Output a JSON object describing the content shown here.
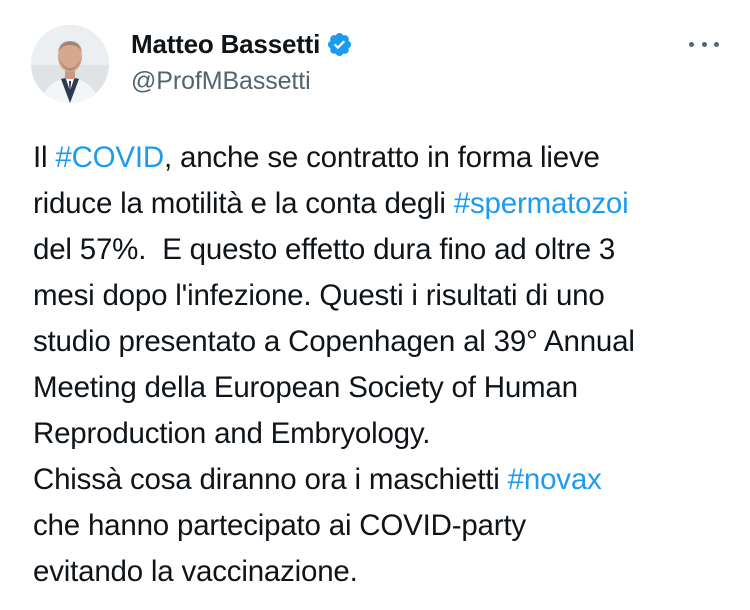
{
  "author": {
    "display_name": "Matteo Bassetti",
    "handle": "@ProfMBassetti",
    "verified_color": "#1d9bf0",
    "avatar_icon": "profile-photo"
  },
  "menu_icon": "more-horizontal-icon",
  "colors": {
    "text": "#0f1419",
    "secondary": "#536471",
    "link": "#1d9bf0"
  },
  "tweet": {
    "lines": [
      [
        {
          "text": "Il ",
          "type": "text"
        },
        {
          "text": "#COVID",
          "type": "hashtag"
        },
        {
          "text": ", anche se contratto in forma lieve",
          "type": "text"
        }
      ],
      [
        {
          "text": "riduce la motilità e la conta degli ",
          "type": "text"
        },
        {
          "text": "#spermatozoi",
          "type": "hashtag"
        }
      ],
      [
        {
          "text": "del 57%.  E questo effetto dura fino ad oltre 3",
          "type": "text"
        }
      ],
      [
        {
          "text": "mesi dopo l'infezione. Questi i risultati di uno",
          "type": "text"
        }
      ],
      [
        {
          "text": "studio presentato a Copenhagen al 39° Annual",
          "type": "text"
        }
      ],
      [
        {
          "text": "Meeting della European Society of Human",
          "type": "text"
        }
      ],
      [
        {
          "text": "Reproduction and Embryology.",
          "type": "text"
        }
      ],
      [
        {
          "text": "Chissà cosa diranno ora i maschietti ",
          "type": "text"
        },
        {
          "text": "#novax",
          "type": "hashtag"
        }
      ],
      [
        {
          "text": "che hanno partecipato ai COVID-party",
          "type": "text"
        }
      ],
      [
        {
          "text": "evitando la vaccinazione.",
          "type": "text"
        }
      ]
    ]
  }
}
